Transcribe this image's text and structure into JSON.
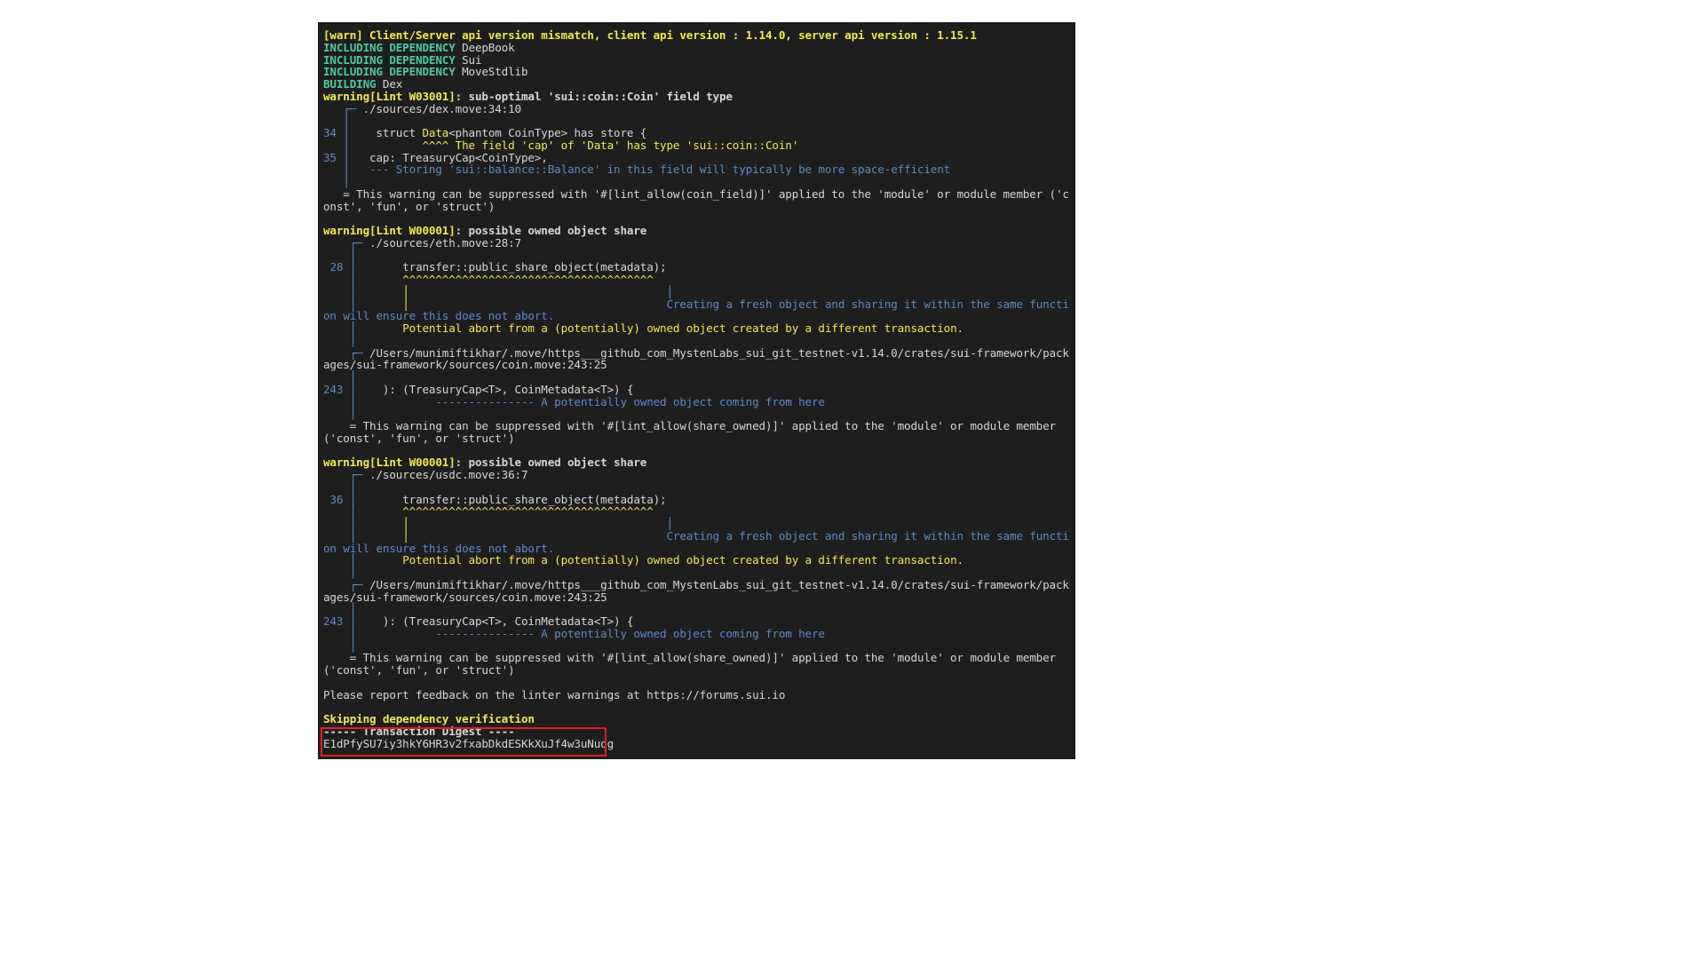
{
  "terminal": {
    "background_color": "#1e1e1e",
    "foreground_color": "#d6d6d6",
    "colors": {
      "warning": "#f2e94e",
      "dependency": "#4ec9a0",
      "note": "#5d8ac9",
      "plain": "#d6d6d6",
      "highlight_box": "#e02020"
    },
    "lines": [
      {
        "id": "api-mismatch",
        "segments": [
          {
            "text": "[warn] Client/Server api version mismatch, client api version : 1.14.0, server api version : 1.15.1",
            "style": "c-warn"
          }
        ]
      },
      {
        "id": "dep-deepbook",
        "segments": [
          {
            "text": "INCLUDING DEPENDENCY ",
            "style": "c-green"
          },
          {
            "text": "DeepBook",
            "style": "c-plain"
          }
        ]
      },
      {
        "id": "dep-sui",
        "segments": [
          {
            "text": "INCLUDING DEPENDENCY ",
            "style": "c-green"
          },
          {
            "text": "Sui",
            "style": "c-plain"
          }
        ]
      },
      {
        "id": "dep-movestdlib",
        "segments": [
          {
            "text": "INCLUDING DEPENDENCY ",
            "style": "c-green"
          },
          {
            "text": "MoveStdlib",
            "style": "c-plain"
          }
        ]
      },
      {
        "id": "building-dex",
        "segments": [
          {
            "text": "BUILDING ",
            "style": "c-green"
          },
          {
            "text": "Dex",
            "style": "c-plain"
          }
        ]
      },
      {
        "id": "warn-w03001",
        "segments": [
          {
            "text": "warning[Lint W03001]",
            "style": "c-warn"
          },
          {
            "text": ": sub-optimal 'sui::coin::Coin' field type",
            "style": "c-plain c-bold"
          }
        ]
      },
      {
        "id": "w03001-loc",
        "segments": [
          {
            "text": "   ┌─ ",
            "style": "c-bluebar"
          },
          {
            "text": "./sources/dex.move:34:10",
            "style": "c-plain"
          }
        ]
      },
      {
        "id": "w03001-gap1",
        "segments": [
          {
            "text": "   │",
            "style": "c-bluebar"
          }
        ]
      },
      {
        "id": "w03001-l34",
        "segments": [
          {
            "text": "34",
            "style": "c-blue"
          },
          {
            "text": " │ ",
            "style": "c-bluebar"
          },
          {
            "text": "   struct ",
            "style": "c-plain"
          },
          {
            "text": "Data",
            "style": "c-yellow"
          },
          {
            "text": "<phantom CoinType> has store {",
            "style": "c-plain"
          }
        ]
      },
      {
        "id": "w03001-caret",
        "segments": [
          {
            "text": "   │ ",
            "style": "c-bluebar"
          },
          {
            "text": "          ^^^^ The field 'cap' of 'Data' has type 'sui::coin::Coin'",
            "style": "c-yellow"
          }
        ]
      },
      {
        "id": "w03001-l35",
        "segments": [
          {
            "text": "35",
            "style": "c-blue"
          },
          {
            "text": " │ ",
            "style": "c-bluebar"
          },
          {
            "text": "  cap: TreasuryCap<CoinType>,",
            "style": "c-plain"
          }
        ]
      },
      {
        "id": "w03001-note",
        "segments": [
          {
            "text": "   │ ",
            "style": "c-bluebar"
          },
          {
            "text": "  --- Storing 'sui::balance::Balance' in this field will typically be more space-efficient",
            "style": "c-blue"
          }
        ]
      },
      {
        "id": "w03001-gap2",
        "segments": [
          {
            "text": "   │",
            "style": "c-bluebar"
          }
        ]
      },
      {
        "id": "w03001-suppress",
        "segments": [
          {
            "text": "   = This warning can be suppressed with '#[lint_allow(coin_field)]' applied to the 'module' or module member ('const', 'fun', or 'struct')",
            "style": "c-plain"
          }
        ]
      },
      {
        "id": "blank-1",
        "segments": []
      },
      {
        "id": "warn-w00001-a",
        "segments": [
          {
            "text": "warning[Lint W00001]",
            "style": "c-warn"
          },
          {
            "text": ": possible owned object share",
            "style": "c-plain c-bold"
          }
        ]
      },
      {
        "id": "w00001a-loc",
        "segments": [
          {
            "text": "    ┌─ ",
            "style": "c-bluebar"
          },
          {
            "text": "./sources/eth.move:28:7",
            "style": "c-plain"
          }
        ]
      },
      {
        "id": "w00001a-gap1",
        "segments": [
          {
            "text": "    │",
            "style": "c-bluebar"
          }
        ]
      },
      {
        "id": "w00001a-l28",
        "segments": [
          {
            "text": " 28",
            "style": "c-blue"
          },
          {
            "text": " │ ",
            "style": "c-bluebar"
          },
          {
            "text": "      transfer::public_share_object(metadata);",
            "style": "c-plain"
          }
        ]
      },
      {
        "id": "w00001a-caret",
        "segments": [
          {
            "text": "    │ ",
            "style": "c-bluebar"
          },
          {
            "text": "      ^^^^^^^^^^^^^^^^^^^^^^^^^^^^^^^^^^^^^^",
            "style": "c-yellow"
          }
        ]
      },
      {
        "id": "w00001a-bars1",
        "segments": [
          {
            "text": "    │ ",
            "style": "c-bluebar"
          },
          {
            "text": "      │                              ",
            "style": "c-yellow"
          },
          {
            "text": "         │",
            "style": "c-blue"
          }
        ]
      },
      {
        "id": "w00001a-msg-blue",
        "segments": [
          {
            "text": "    │ ",
            "style": "c-bluebar"
          },
          {
            "text": "      │                              ",
            "style": "c-yellow"
          },
          {
            "text": "         Creating a fresh object and sharing it within the same function will ensure this does not abort.",
            "style": "c-blue"
          }
        ]
      },
      {
        "id": "w00001a-msg-yellow",
        "segments": [
          {
            "text": "    │ ",
            "style": "c-bluebar"
          },
          {
            "text": "      Potential abort from a (potentially) owned object created by a different transaction.",
            "style": "c-yellow"
          }
        ]
      },
      {
        "id": "w00001a-gap2",
        "segments": [
          {
            "text": "    │",
            "style": "c-bluebar"
          }
        ]
      },
      {
        "id": "w00001a-path",
        "segments": [
          {
            "text": "    ┌─ ",
            "style": "c-bluebar"
          },
          {
            "text": "/Users/munimiftikhar/.move/https___github_com_MystenLabs_sui_git_testnet-v1.14.0/crates/sui-framework/packages/sui-framework/sources/coin.move:243:25",
            "style": "c-plain"
          }
        ]
      },
      {
        "id": "w00001a-gap3",
        "segments": [
          {
            "text": "    │",
            "style": "c-bluebar"
          }
        ]
      },
      {
        "id": "w00001a-l243",
        "segments": [
          {
            "text": "243",
            "style": "c-blue"
          },
          {
            "text": " │ ",
            "style": "c-bluebar"
          },
          {
            "text": "   ): (TreasuryCap<T>, CoinMetadata<T>) {",
            "style": "c-plain"
          }
        ]
      },
      {
        "id": "w00001a-dash",
        "segments": [
          {
            "text": "    │ ",
            "style": "c-bluebar"
          },
          {
            "text": "           --------------- A potentially owned object coming from here",
            "style": "c-blue"
          }
        ]
      },
      {
        "id": "w00001a-gap4",
        "segments": [
          {
            "text": "    │",
            "style": "c-bluebar"
          }
        ]
      },
      {
        "id": "w00001a-suppress",
        "segments": [
          {
            "text": "    = This warning can be suppressed with '#[lint_allow(share_owned)]' applied to the 'module' or module member ('const', 'fun', or 'struct')",
            "style": "c-plain"
          }
        ]
      },
      {
        "id": "blank-2",
        "segments": []
      },
      {
        "id": "warn-w00001-b",
        "segments": [
          {
            "text": "warning[Lint W00001]",
            "style": "c-warn"
          },
          {
            "text": ": possible owned object share",
            "style": "c-plain c-bold"
          }
        ]
      },
      {
        "id": "w00001b-loc",
        "segments": [
          {
            "text": "    ┌─ ",
            "style": "c-bluebar"
          },
          {
            "text": "./sources/usdc.move:36:7",
            "style": "c-plain"
          }
        ]
      },
      {
        "id": "w00001b-gap1",
        "segments": [
          {
            "text": "    │",
            "style": "c-bluebar"
          }
        ]
      },
      {
        "id": "w00001b-l36",
        "segments": [
          {
            "text": " 36",
            "style": "c-blue"
          },
          {
            "text": " │ ",
            "style": "c-bluebar"
          },
          {
            "text": "      transfer::public_share_object(metadata);",
            "style": "c-plain"
          }
        ]
      },
      {
        "id": "w00001b-caret",
        "segments": [
          {
            "text": "    │ ",
            "style": "c-bluebar"
          },
          {
            "text": "      ^^^^^^^^^^^^^^^^^^^^^^^^^^^^^^^^^^^^^^",
            "style": "c-yellow"
          }
        ]
      },
      {
        "id": "w00001b-bars1",
        "segments": [
          {
            "text": "    │ ",
            "style": "c-bluebar"
          },
          {
            "text": "      │                              ",
            "style": "c-yellow"
          },
          {
            "text": "         │",
            "style": "c-blue"
          }
        ]
      },
      {
        "id": "w00001b-msg-blue",
        "segments": [
          {
            "text": "    │ ",
            "style": "c-bluebar"
          },
          {
            "text": "      │                              ",
            "style": "c-yellow"
          },
          {
            "text": "         Creating a fresh object and sharing it within the same function will ensure this does not abort.",
            "style": "c-blue"
          }
        ]
      },
      {
        "id": "w00001b-msg-yellow",
        "segments": [
          {
            "text": "    │ ",
            "style": "c-bluebar"
          },
          {
            "text": "      Potential abort from a (potentially) owned object created by a different transaction.",
            "style": "c-yellow"
          }
        ]
      },
      {
        "id": "w00001b-gap2",
        "segments": [
          {
            "text": "    │",
            "style": "c-bluebar"
          }
        ]
      },
      {
        "id": "w00001b-path",
        "segments": [
          {
            "text": "    ┌─ ",
            "style": "c-bluebar"
          },
          {
            "text": "/Users/munimiftikhar/.move/https___github_com_MystenLabs_sui_git_testnet-v1.14.0/crates/sui-framework/packages/sui-framework/sources/coin.move:243:25",
            "style": "c-plain"
          }
        ]
      },
      {
        "id": "w00001b-gap3",
        "segments": [
          {
            "text": "    │",
            "style": "c-bluebar"
          }
        ]
      },
      {
        "id": "w00001b-l243",
        "segments": [
          {
            "text": "243",
            "style": "c-blue"
          },
          {
            "text": " │ ",
            "style": "c-bluebar"
          },
          {
            "text": "   ): (TreasuryCap<T>, CoinMetadata<T>) {",
            "style": "c-plain"
          }
        ]
      },
      {
        "id": "w00001b-dash",
        "segments": [
          {
            "text": "    │ ",
            "style": "c-bluebar"
          },
          {
            "text": "           --------------- A potentially owned object coming from here",
            "style": "c-blue"
          }
        ]
      },
      {
        "id": "w00001b-gap4",
        "segments": [
          {
            "text": "    │",
            "style": "c-bluebar"
          }
        ]
      },
      {
        "id": "w00001b-suppress",
        "segments": [
          {
            "text": "    = This warning can be suppressed with '#[lint_allow(share_owned)]' applied to the 'module' or module member ('const', 'fun', or 'struct')",
            "style": "c-plain"
          }
        ]
      },
      {
        "id": "blank-3",
        "segments": []
      },
      {
        "id": "feedback",
        "segments": [
          {
            "text": "Please report feedback on the linter warnings at https://forums.sui.io",
            "style": "c-plain"
          }
        ]
      },
      {
        "id": "blank-4",
        "segments": []
      },
      {
        "id": "skipping-dep-verification",
        "segments": [
          {
            "text": "Skipping dependency verification",
            "style": "c-warn"
          }
        ]
      },
      {
        "id": "digest-header",
        "segments": [
          {
            "text": "----- Transaction Digest ----",
            "style": "c-plain c-bold"
          }
        ]
      },
      {
        "id": "digest-value",
        "segments": [
          {
            "text": "E1dPfySU7iy3hkY6HR3v2fxabDkdESKkXuJf4w3uNuog",
            "style": "c-plain"
          }
        ]
      }
    ]
  },
  "annotations": {
    "digest_highlight": {
      "label": "transaction-digest-highlight",
      "color": "#e02020"
    }
  }
}
